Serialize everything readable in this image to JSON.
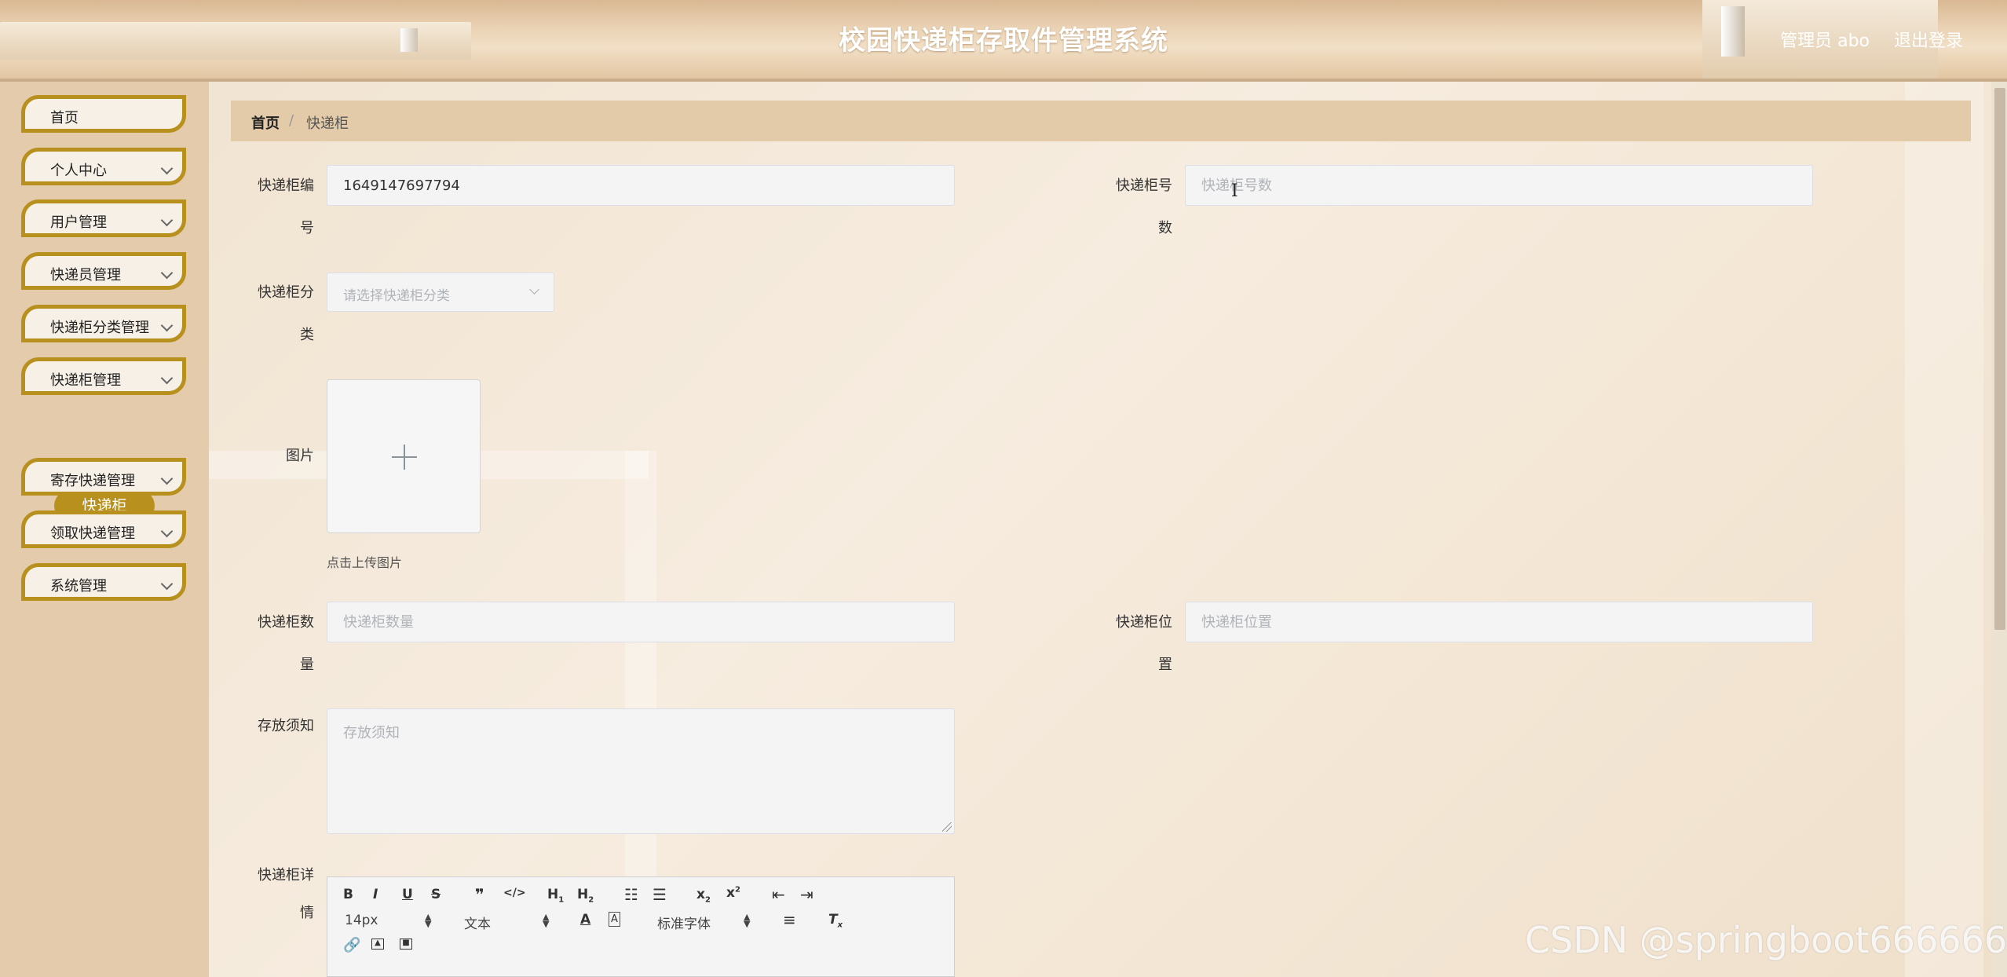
{
  "header": {
    "title": "校园快递柜存取件管理系统",
    "user": "管理员 abo",
    "logout": "退出登录"
  },
  "sidebar": {
    "items": [
      {
        "label": "首页",
        "expandable": false
      },
      {
        "label": "个人中心",
        "expandable": true
      },
      {
        "label": "用户管理",
        "expandable": true
      },
      {
        "label": "快递员管理",
        "expandable": true
      },
      {
        "label": "快递柜分类管理",
        "expandable": true
      },
      {
        "label": "快递柜管理",
        "expandable": true
      },
      {
        "label": "寄存快递管理",
        "expandable": true
      },
      {
        "label": "领取快递管理",
        "expandable": true
      },
      {
        "label": "系统管理",
        "expandable": true
      }
    ],
    "active_sub": "快递柜"
  },
  "breadcrumb": {
    "home": "首页",
    "separator": "/",
    "current": "快递柜"
  },
  "form": {
    "locker_no": {
      "label_1": "快递柜编",
      "label_2": "号",
      "value": "1649147697794"
    },
    "locker_count_no": {
      "label_1": "快递柜号",
      "label_2": "数",
      "placeholder": "快递柜号数"
    },
    "category": {
      "label_1": "快递柜分",
      "label_2": "类",
      "placeholder": "请选择快递柜分类"
    },
    "image": {
      "label": "图片",
      "tip": "点击上传图片"
    },
    "quantity": {
      "label_1": "快递柜数",
      "label_2": "量",
      "placeholder": "快递柜数量"
    },
    "location": {
      "label_1": "快递柜位",
      "label_2": "置",
      "placeholder": "快递柜位置"
    },
    "notice": {
      "label": "存放须知",
      "placeholder": "存放须知"
    },
    "details": {
      "label_1": "快递柜详",
      "label_2": "情"
    }
  },
  "editor_toolbar": {
    "font_size": "14px",
    "heading": "文本",
    "font_family": "标准字体"
  },
  "watermark": "CSDN @springboot666666",
  "colors": {
    "accent": "#b8901d",
    "sidebar_bg": "#e4cbab",
    "breadcrumb_bg": "#e3cba9"
  }
}
